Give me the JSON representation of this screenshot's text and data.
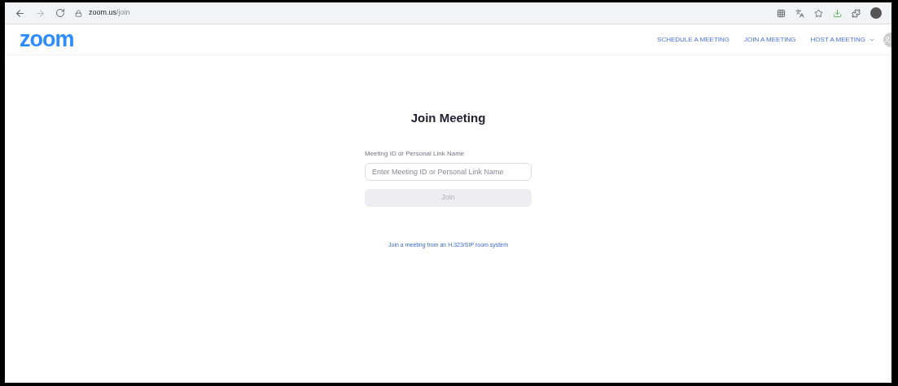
{
  "browser": {
    "url_host": "zoom.us",
    "url_path": "/join"
  },
  "header": {
    "logo": "zoom",
    "nav": [
      {
        "label": "SCHEDULE A MEETING",
        "dropdown": false
      },
      {
        "label": "JOIN A MEETING",
        "dropdown": false
      },
      {
        "label": "HOST A MEETING",
        "dropdown": true
      }
    ]
  },
  "form": {
    "title": "Join Meeting",
    "field_label": "Meeting ID or Personal Link Name",
    "placeholder": "Enter Meeting ID or Personal Link Name",
    "button": {
      "label": "Join",
      "disabled": true
    },
    "link": "Join a meeting from an H.323/SIP room system"
  }
}
